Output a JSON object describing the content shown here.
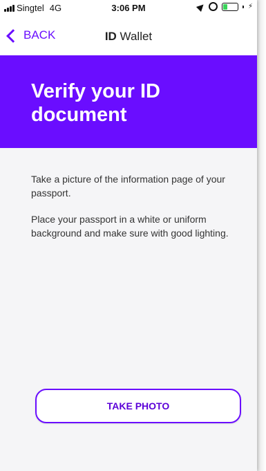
{
  "status_bar": {
    "carrier": "Singtel",
    "network": "4G",
    "time": "3:06 PM",
    "icons": [
      "signal-bars-icon",
      "location-icon",
      "alarm-icon",
      "battery-icon",
      "charging-bolt-icon"
    ]
  },
  "nav": {
    "back_label": "BACK",
    "title_bold": "ID",
    "title_rest": " Wallet"
  },
  "hero": {
    "title": "Verify your ID document"
  },
  "instructions": {
    "line1": "Take a picture of the information page of your passport.",
    "line2": "Place your passport in a white or uniform background and make sure with good lighting."
  },
  "actions": {
    "take_photo_label": "TAKE PHOTO"
  },
  "colors": {
    "accent": "#6a0dff",
    "page_bg": "#f5f5f7",
    "battery_level_color": "#3bd35a"
  }
}
